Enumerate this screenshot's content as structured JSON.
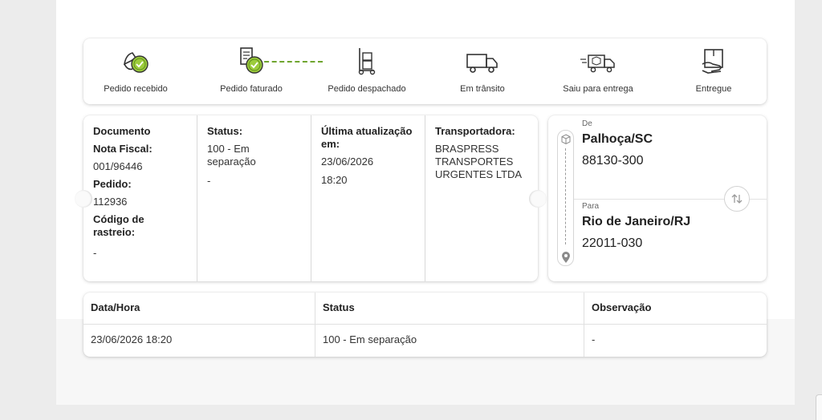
{
  "progress": {
    "steps": [
      {
        "label": "Pedido recebido",
        "icon": "hand-box-check-icon",
        "done": true
      },
      {
        "label": "Pedido faturado",
        "icon": "invoice-check-icon",
        "done": true
      },
      {
        "label": "Pedido despachado",
        "icon": "hand-truck-icon",
        "done": false
      },
      {
        "label": "Em trânsito",
        "icon": "truck-icon",
        "done": false
      },
      {
        "label": "Saiu para entrega",
        "icon": "fast-delivery-truck-icon",
        "done": false
      },
      {
        "label": "Entregue",
        "icon": "delivered-box-icon",
        "done": false
      }
    ],
    "accent": "#6fa52f"
  },
  "info": {
    "documento_label": "Documento",
    "nota_label": "Nota Fiscal:",
    "nota_value": "001/96446",
    "pedido_label": "Pedido:",
    "pedido_value": "112936",
    "codigo_label": "Código de rastreio:",
    "codigo_value": "-",
    "status_label": "Status:",
    "status_value": "100 - Em separação",
    "status_extra": "-",
    "atualizacao_label": "Última atualização em:",
    "atualizacao_date": "23/06/2026",
    "atualizacao_time": "18:20",
    "transportadora_label": "Transportadora:",
    "transportadora_value": "BRASPRESS TRANSPORTES URGENTES LTDA"
  },
  "route": {
    "from_label": "De",
    "from_city": "Palhoça/SC",
    "from_zip": "88130-300",
    "to_label": "Para",
    "to_city": "Rio de Janeiro/RJ",
    "to_zip": "22011-030"
  },
  "history": {
    "headers": [
      "Data/Hora",
      "Status",
      "Observação"
    ],
    "rows": [
      [
        "23/06/2026 18:20",
        "100 - Em separação",
        "-"
      ]
    ]
  }
}
